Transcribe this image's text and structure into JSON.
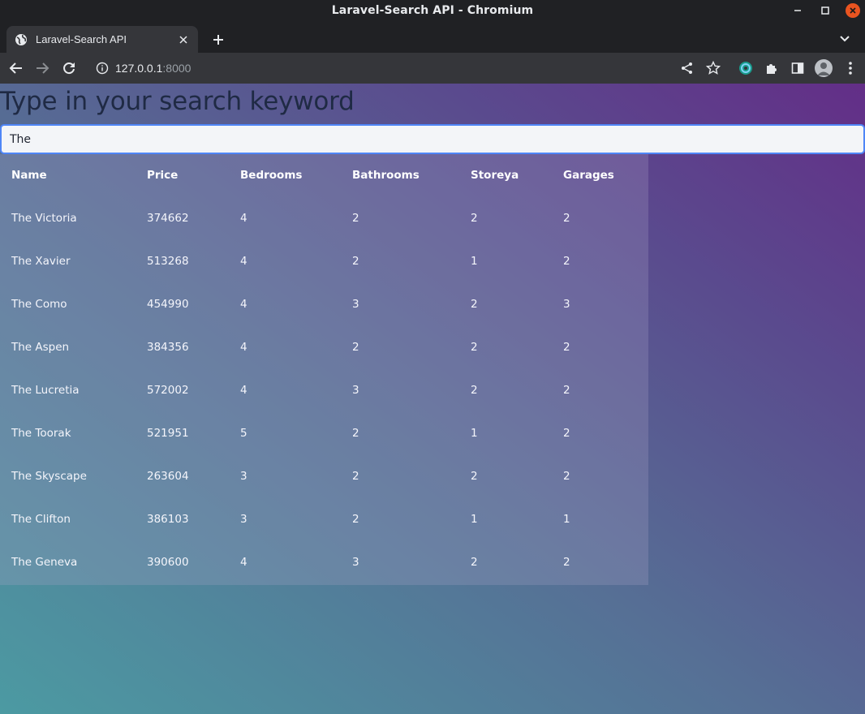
{
  "window": {
    "title": "Laravel-Search API - Chromium",
    "close_color": "#e95420"
  },
  "tab": {
    "title": "Laravel-Search API"
  },
  "toolbar": {
    "url_host": "127.0.0.1",
    "url_port": ":8000"
  },
  "page": {
    "heading": "Type in your search keyword",
    "search_value": "The",
    "table": {
      "headers": [
        "Name",
        "Price",
        "Bedrooms",
        "Bathrooms",
        "Storeya",
        "Garages"
      ],
      "rows": [
        [
          "The Victoria",
          "374662",
          "4",
          "2",
          "2",
          "2"
        ],
        [
          "The Xavier",
          "513268",
          "4",
          "2",
          "1",
          "2"
        ],
        [
          "The Como",
          "454990",
          "4",
          "3",
          "2",
          "3"
        ],
        [
          "The Aspen",
          "384356",
          "4",
          "2",
          "2",
          "2"
        ],
        [
          "The Lucretia",
          "572002",
          "4",
          "3",
          "2",
          "2"
        ],
        [
          "The Toorak",
          "521951",
          "5",
          "2",
          "1",
          "2"
        ],
        [
          "The Skyscape",
          "263604",
          "3",
          "2",
          "2",
          "2"
        ],
        [
          "The Clifton",
          "386103",
          "3",
          "2",
          "1",
          "1"
        ],
        [
          "The Geneva",
          "390600",
          "4",
          "3",
          "2",
          "2"
        ]
      ]
    }
  },
  "icons": {
    "favicon": "globe-icon",
    "back": "arrow-left-icon",
    "forward": "arrow-right-icon",
    "reload": "reload-icon",
    "info": "info-icon",
    "share": "share-icon",
    "bookmark": "star-icon",
    "extension_green": "extension-app-icon",
    "extensions": "puzzle-icon",
    "side_panel": "side-panel-icon",
    "profile": "profile-avatar-icon",
    "menu": "kebab-menu-icon"
  }
}
